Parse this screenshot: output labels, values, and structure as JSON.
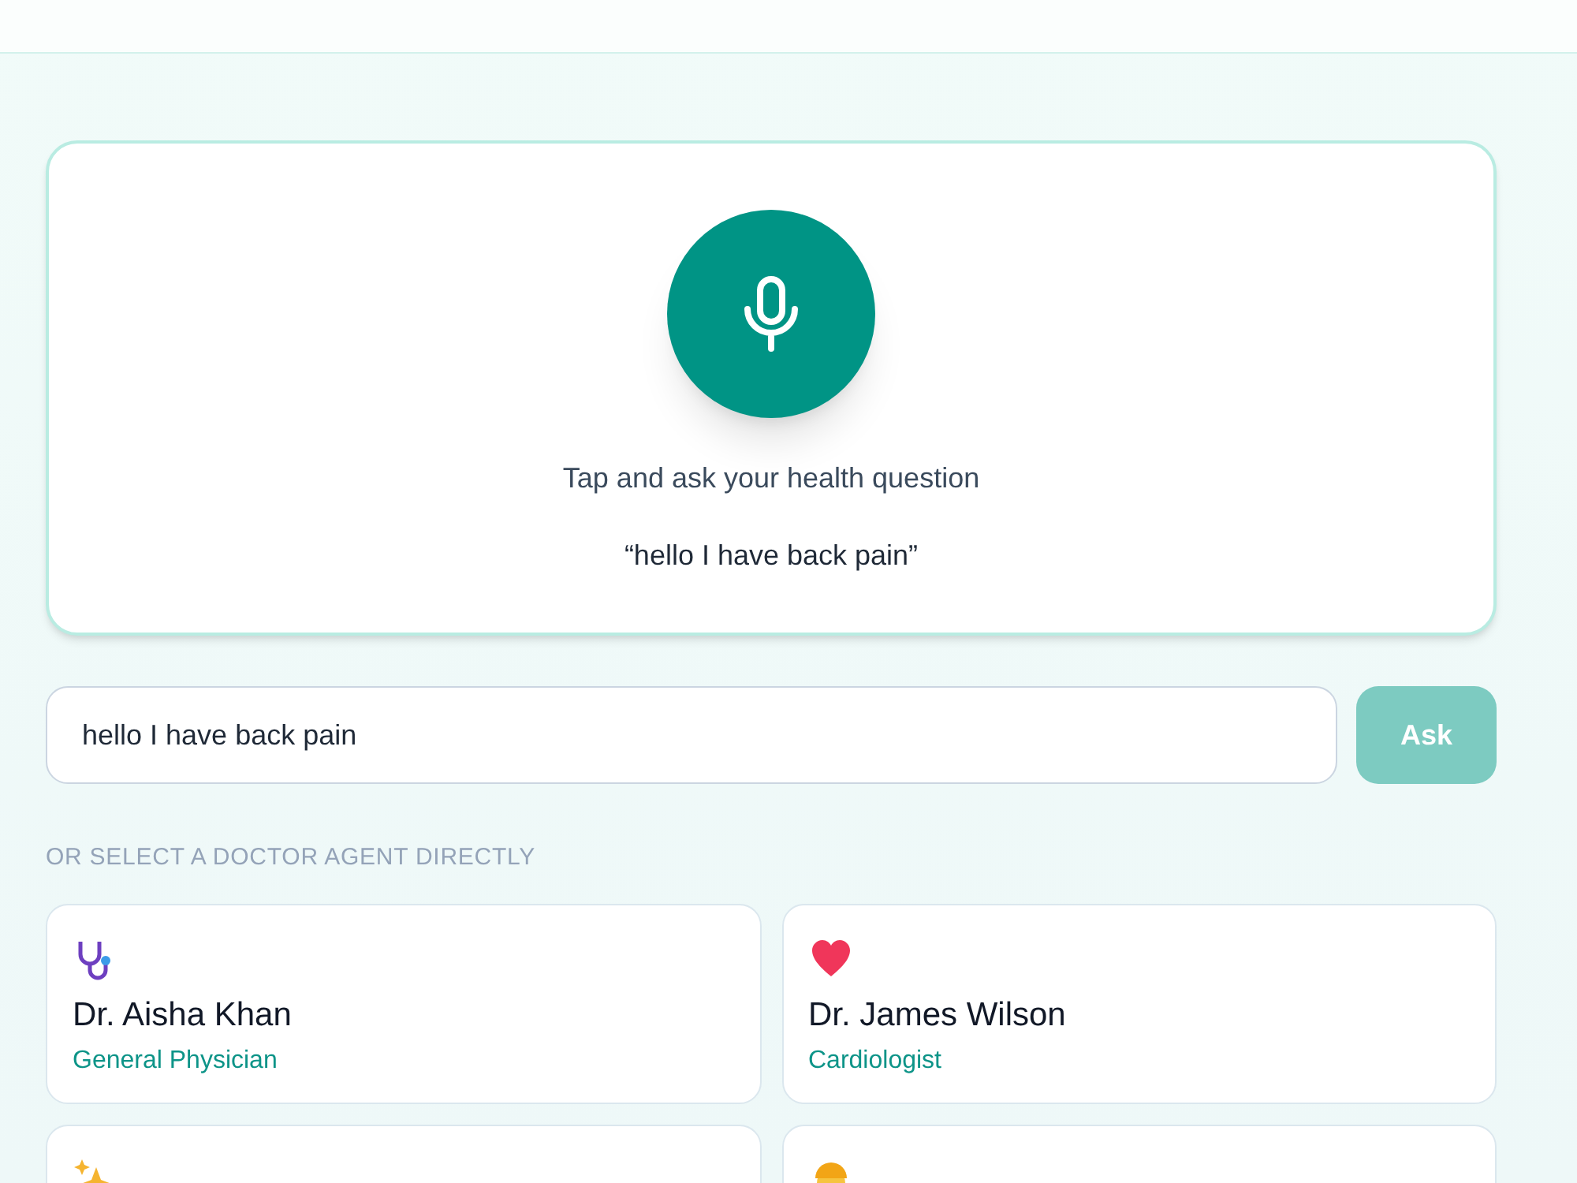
{
  "voice_panel": {
    "prompt": "Tap and ask your health question",
    "transcript": "“hello I have back pain”"
  },
  "question": {
    "value": "hello I have back pain",
    "button": "Ask",
    "disabled": true
  },
  "section_label": "OR SELECT A DOCTOR AGENT DIRECTLY",
  "doctors": [
    {
      "name": "Dr. Aisha Khan",
      "specialty": "General Physician"
    },
    {
      "name": "Dr. James Wilson",
      "specialty": "Cardiologist"
    }
  ]
}
